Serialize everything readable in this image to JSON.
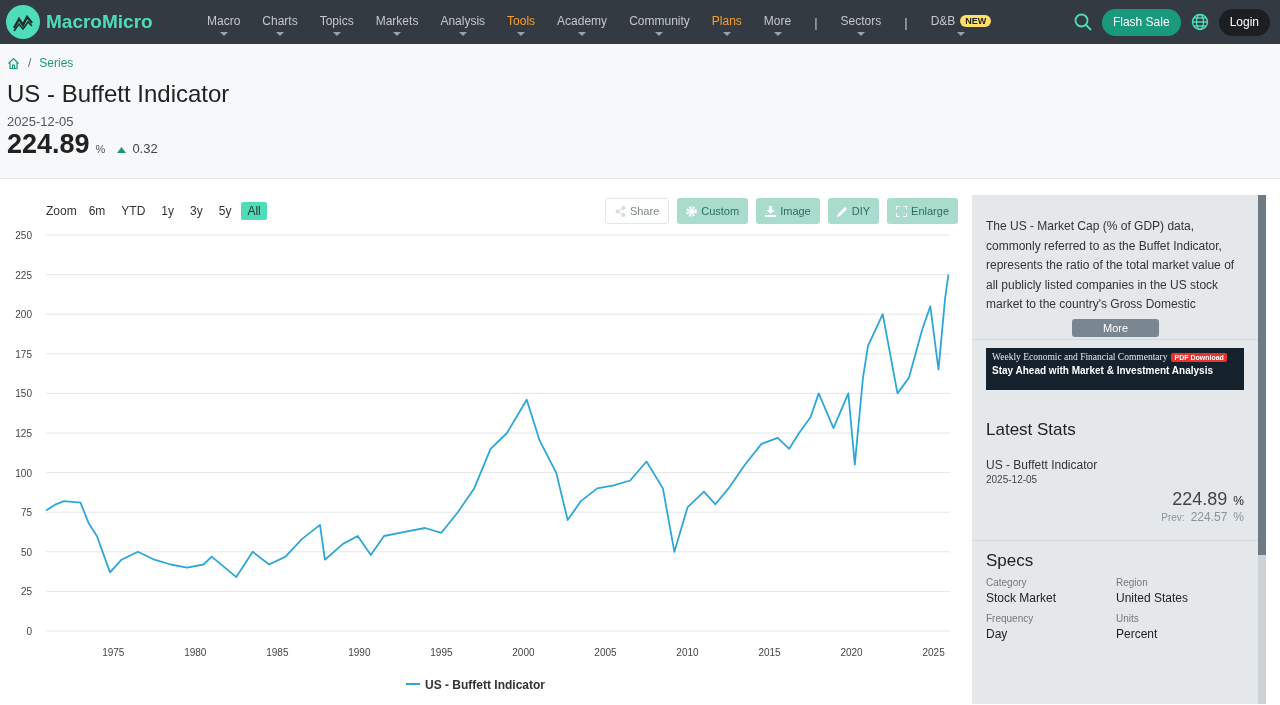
{
  "logo": {
    "text": "MacroMicro"
  },
  "nav": [
    {
      "kind": "menu",
      "label": "Macro",
      "highlight": false
    },
    {
      "kind": "menu",
      "label": "Charts",
      "highlight": false
    },
    {
      "kind": "menu",
      "label": "Topics",
      "highlight": false
    },
    {
      "kind": "menu",
      "label": "Markets",
      "highlight": false
    },
    {
      "kind": "menu",
      "label": "Analysis",
      "highlight": false
    },
    {
      "kind": "menu",
      "label": "Tools",
      "highlight": true
    },
    {
      "kind": "menu",
      "label": "Academy",
      "highlight": false
    },
    {
      "kind": "menu",
      "label": "Community",
      "highlight": false
    },
    {
      "kind": "menu",
      "label": "Plans",
      "highlight": true
    },
    {
      "kind": "menu",
      "label": "More",
      "highlight": false
    },
    {
      "kind": "divider",
      "label": "|"
    },
    {
      "kind": "menu",
      "label": "Sectors",
      "highlight": false
    },
    {
      "kind": "divider",
      "label": "|"
    },
    {
      "kind": "menu",
      "label": "D&B",
      "highlight": false,
      "badge": "NEW"
    }
  ],
  "header_actions": {
    "flash_sale": "Flash Sale",
    "login": "Login"
  },
  "breadcrumb_separator": "/",
  "breadcrumb": [
    "Series"
  ],
  "title": "US - Buffett Indicator",
  "date": "2025-12-05",
  "value": "224.89",
  "unit": "%",
  "change": "0.32",
  "zoom_label": "Zoom",
  "range_buttons": [
    {
      "label": "6m",
      "selected": false
    },
    {
      "label": "YTD",
      "selected": false
    },
    {
      "label": "1y",
      "selected": false
    },
    {
      "label": "3y",
      "selected": false
    },
    {
      "label": "5y",
      "selected": false
    },
    {
      "label": "All",
      "selected": true
    }
  ],
  "chart_tools": [
    {
      "kind": "share",
      "label": "Share"
    },
    {
      "kind": "custom",
      "label": "Custom"
    },
    {
      "kind": "image",
      "label": "Image"
    },
    {
      "kind": "diy",
      "label": "DIY"
    },
    {
      "kind": "enlarge",
      "label": "Enlarge"
    }
  ],
  "chart_data": {
    "type": "line",
    "grid": true,
    "xlim": [
      1970.9,
      2026
    ],
    "ylim": [
      0,
      250
    ],
    "xticks": [
      1975,
      1980,
      1985,
      1990,
      1995,
      2000,
      2005,
      2010,
      2015,
      2020,
      2025
    ],
    "yticks": [
      0,
      25,
      50,
      75,
      100,
      125,
      150,
      175,
      200,
      225,
      250
    ],
    "x": [
      1970.9,
      1971.5,
      1972,
      1973,
      1973.5,
      1974,
      1974.8,
      1975.5,
      1976.5,
      1977.5,
      1978.5,
      1979.5,
      1980.5,
      1981,
      1982.5,
      1983.5,
      1984.5,
      1985.5,
      1986.5,
      1987.6,
      1987.9,
      1989,
      1989.9,
      1990.7,
      1991.5,
      1993,
      1994,
      1995,
      1996,
      1997,
      1998,
      1999,
      2000.2,
      2001,
      2002,
      2002.7,
      2003.5,
      2004.5,
      2005.5,
      2006.5,
      2007.5,
      2008.5,
      2009.2,
      2010,
      2011,
      2011.7,
      2012.5,
      2013.5,
      2014.5,
      2015.5,
      2016.2,
      2016.8,
      2017.5,
      2018,
      2018.9,
      2019.8,
      2020.2,
      2020.7,
      2021,
      2021.9,
      2022.8,
      2023.5,
      2024.3,
      2024.8,
      2025.3,
      2025.7,
      2025.9
    ],
    "series": [
      {
        "name": "US - Buffett Indicator",
        "color": "#2ea7d8",
        "values": [
          76,
          80,
          82,
          81,
          68,
          60,
          37,
          45,
          50,
          45,
          42,
          40,
          42,
          47,
          34,
          50,
          42,
          47,
          58,
          67,
          45,
          55,
          60,
          48,
          60,
          63,
          65,
          62,
          75,
          90,
          115,
          125,
          146,
          120,
          100,
          70,
          82,
          90,
          92,
          95,
          107,
          90,
          50,
          78,
          88,
          80,
          90,
          105,
          118,
          122,
          115,
          125,
          135,
          150,
          128,
          150,
          105,
          160,
          180,
          200,
          150,
          160,
          190,
          205,
          165,
          210,
          225
        ]
      }
    ]
  },
  "description": "The US - Market Cap (% of GDP) data, commonly referred to as the Buffet Indicator, represents the ratio of the total market value of all publicly listed companies in the US stock market to the country's Gross Domestic",
  "more_button": "More",
  "banner": {
    "line1": "Weekly Economic and Financial Commentary",
    "tag": "PDF Download",
    "line2": "Stay Ahead with  Market & Investment Analysis"
  },
  "latest_stats": {
    "heading": "Latest Stats",
    "name": "US - Buffett Indicator",
    "date": "2025-12-05",
    "value": "224.89",
    "unit": "%",
    "prev_label": "Prev:",
    "prev_value": "224.57",
    "prev_unit": "%"
  },
  "specs": {
    "heading": "Specs",
    "items": [
      {
        "label": "Category",
        "value": "Stock Market"
      },
      {
        "label": "Region",
        "value": "United States"
      },
      {
        "label": "Frequency",
        "value": "Day"
      },
      {
        "label": "Units",
        "value": "Percent"
      }
    ]
  }
}
